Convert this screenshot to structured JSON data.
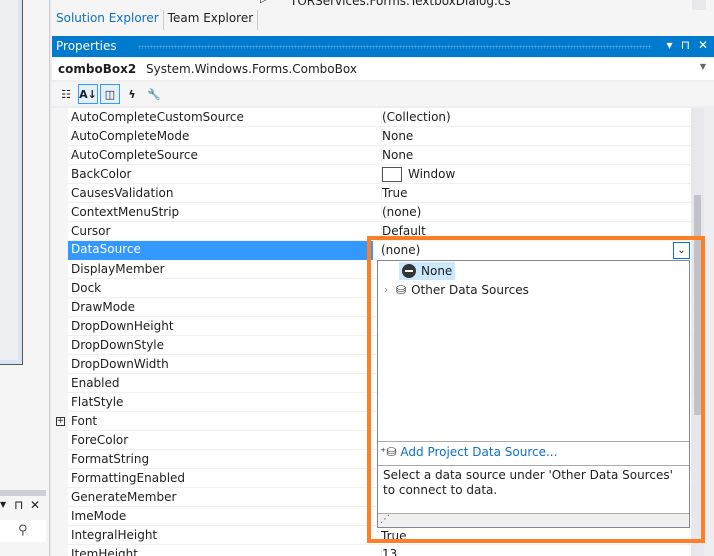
{
  "solution_explorer": {
    "tree_item": "TORServices.Forms.TextboxDialog.cs",
    "tabs": [
      {
        "label": "Solution Explorer",
        "active": true
      },
      {
        "label": "Team Explorer",
        "active": false
      }
    ]
  },
  "properties": {
    "title": "Properties",
    "header_buttons": [
      "▾",
      "⊓",
      "✕"
    ],
    "object_name": "comboBox2",
    "object_type": "System.Windows.Forms.ComboBox",
    "toolbar": [
      "categorized-icon",
      "alphabetical-icon",
      "properties-icon",
      "events-icon",
      "property-pages-icon"
    ],
    "rows": [
      {
        "name": "AutoCompleteCustomSource",
        "value": "(Collection)"
      },
      {
        "name": "AutoCompleteMode",
        "value": "None"
      },
      {
        "name": "AutoCompleteSource",
        "value": "None"
      },
      {
        "name": "BackColor",
        "value": "Window",
        "swatch": "#ffffff"
      },
      {
        "name": "CausesValidation",
        "value": "True"
      },
      {
        "name": "ContextMenuStrip",
        "value": "(none)"
      },
      {
        "name": "Cursor",
        "value": "Default"
      },
      {
        "name": "DataSource",
        "value": "",
        "selected": true
      },
      {
        "name": "DisplayMember",
        "value": ""
      },
      {
        "name": "Dock",
        "value": ""
      },
      {
        "name": "DrawMode",
        "value": ""
      },
      {
        "name": "DropDownHeight",
        "value": ""
      },
      {
        "name": "DropDownStyle",
        "value": ""
      },
      {
        "name": "DropDownWidth",
        "value": ""
      },
      {
        "name": "Enabled",
        "value": ""
      },
      {
        "name": "FlatStyle",
        "value": ""
      },
      {
        "name": "Font",
        "value": "",
        "expandable": true
      },
      {
        "name": "ForeColor",
        "value": ""
      },
      {
        "name": "FormatString",
        "value": ""
      },
      {
        "name": "FormattingEnabled",
        "value": ""
      },
      {
        "name": "GenerateMember",
        "value": ""
      },
      {
        "name": "ImeMode",
        "value": ""
      },
      {
        "name": "IntegralHeight",
        "value": ""
      },
      {
        "name": "ItemHeight",
        "value": "13"
      }
    ]
  },
  "datasource_dropdown": {
    "value": "(none)",
    "items": [
      {
        "label": "None",
        "selected": true
      },
      {
        "label": "Other Data Sources",
        "expandable": true
      }
    ],
    "add_link": "Add Project Data Source...",
    "description": "Select a data source under 'Other Data Sources' to connect to data.",
    "below_value": "True"
  },
  "colors": {
    "accent": "#007acc",
    "highlight": "#ff7f27",
    "selection": "#3399ff"
  }
}
